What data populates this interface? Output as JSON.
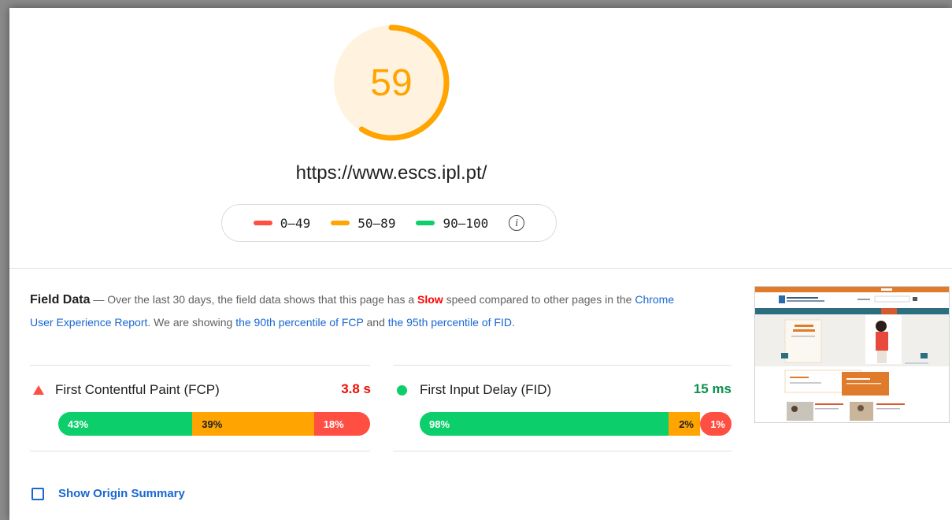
{
  "score": {
    "value": "59",
    "fraction": 0.59,
    "color": "#ffa400",
    "bg": "#fff3e0"
  },
  "url": "https://www.escs.ipl.pt/",
  "legend": {
    "items": [
      {
        "label": "0–49",
        "color": "#ff4e42"
      },
      {
        "label": "50–89",
        "color": "#ffa400"
      },
      {
        "label": "90–100",
        "color": "#0cce6b"
      }
    ],
    "info_icon": "info-icon"
  },
  "field": {
    "title": "Field Data",
    "dash": " — ",
    "text1": "Over the last 30 days, the field data shows that this page has a ",
    "slow": "Slow",
    "text2": " speed compared to other pages in the ",
    "link_report": "Chrome User Experience Report",
    "text3": ". We are showing ",
    "link_fcp": "the 90th percentile of FCP",
    "text4": " and ",
    "link_fid": "the 95th percentile of FID",
    "text5": "."
  },
  "metrics": {
    "fcp": {
      "label": "First Contentful Paint (FCP)",
      "value": "3.8 s",
      "value_color": "#eb0f00",
      "icon": "triangle-icon",
      "segments": [
        {
          "label": "43%",
          "fraction": 0.43,
          "color": "#0cce6b"
        },
        {
          "label": "39%",
          "fraction": 0.39,
          "color": "#ffa400"
        },
        {
          "label": "18%",
          "fraction": 0.18,
          "color": "#ff4e42"
        }
      ]
    },
    "fid": {
      "label": "First Input Delay (FID)",
      "value": "15 ms",
      "value_color": "#0d904f",
      "icon": "circle-icon",
      "segments": [
        {
          "label": "98%",
          "fraction": 0.98,
          "color": "#0cce6b"
        },
        {
          "label": "2%",
          "fraction": 0.02,
          "color": "#ffa400"
        },
        {
          "label": "1%",
          "fraction": 0.01,
          "color": "#ff4e42"
        }
      ]
    }
  },
  "origin_summary": {
    "label": "Show Origin Summary",
    "checked": false
  }
}
